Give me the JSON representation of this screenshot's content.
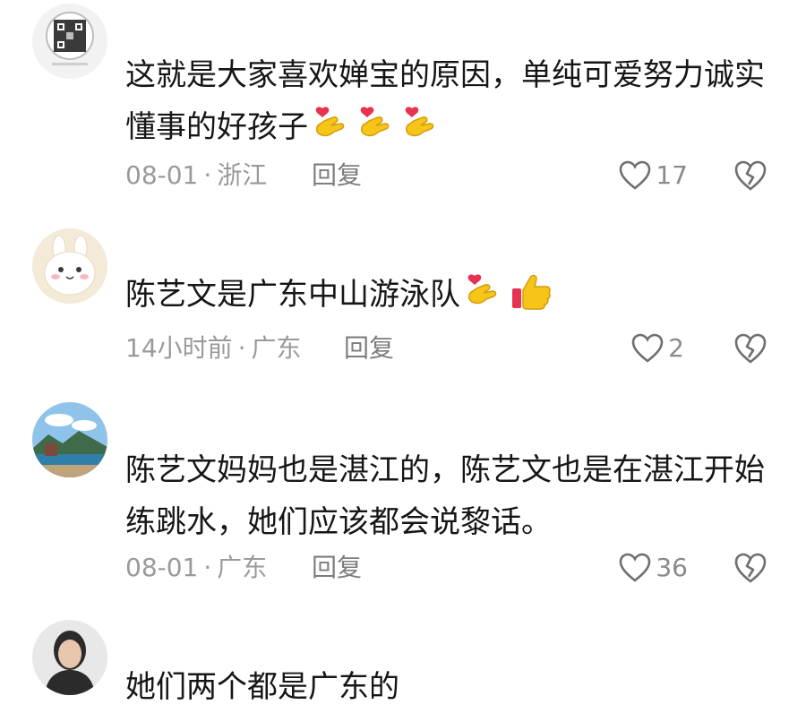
{
  "comments": [
    {
      "username": "",
      "text_lines": [
        "这就是大家喜欢婵宝的原因，单纯可爱努力诚实",
        "懂事的好孩子"
      ],
      "emojis": [
        "heart-fingers-emoji",
        "heart-fingers-emoji",
        "heart-fingers-emoji"
      ],
      "date": "08-01",
      "location": "浙江",
      "reply": "回复",
      "likes": "17",
      "avatar": "qr-code-avatar"
    },
    {
      "username": "",
      "text_lines": [
        "陈艺文是广东中山游泳队"
      ],
      "emojis": [
        "heart-fingers-emoji",
        "thumbs-up-emoji"
      ],
      "date": "14小时前",
      "location": "广东",
      "reply": "回复",
      "likes": "2",
      "avatar": "bunny-avatar"
    },
    {
      "username": "",
      "text_lines": [
        "陈艺文妈妈也是湛江的，陈艺文也是在湛江开始",
        "练跳水，她们应该都会说黎话。"
      ],
      "emojis": [],
      "date": "08-01",
      "location": "广东",
      "reply": "回复",
      "likes": "36",
      "avatar": "landscape-avatar"
    },
    {
      "username": "",
      "text_lines": [
        "她们两个都是广东的"
      ],
      "emojis": [],
      "avatar": "person-avatar"
    }
  ],
  "separator": "·",
  "icons": {
    "like": "heart-outline-icon",
    "dislike": "broken-heart-icon"
  }
}
